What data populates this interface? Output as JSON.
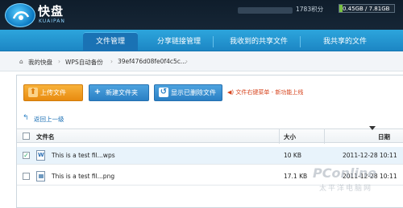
{
  "header": {
    "logo_text": "快盘",
    "logo_sub": "KUAIPAN",
    "points": "1783积分",
    "storage_text": "0.45GB / 7.81GB",
    "storage_used_fraction": 0.058
  },
  "nav": {
    "tabs": [
      {
        "label": "文件管理",
        "active": true
      },
      {
        "label": "分享链接管理",
        "active": false
      },
      {
        "label": "我收到的共享文件",
        "active": false
      },
      {
        "label": "我共享的文件",
        "active": false
      }
    ]
  },
  "breadcrumb": {
    "items": [
      "我的快盘",
      "WPS自动备份",
      "39ef476d08fe0f4c5c..."
    ]
  },
  "toolbar": {
    "upload_label": "上传文件",
    "new_folder_label": "新建文件夹",
    "show_deleted_label": "显示已删除文件",
    "notice": "文件右键菜单 - 新功能上线"
  },
  "back_label": "返回上一级",
  "table": {
    "columns": [
      "文件名",
      "大小",
      "日期"
    ],
    "rows": [
      {
        "name": "This is a test fil...wps",
        "size": "10 KB",
        "date": "2011-12-28 10:11",
        "checked": true,
        "type": "wps"
      },
      {
        "name": "This is a test fil...png",
        "size": "17.1 KB",
        "date": "2011-12-28 10:11",
        "checked": false,
        "type": "png"
      }
    ]
  },
  "watermark": {
    "text": "PConline",
    "sub": "太平洋电脑网"
  },
  "colors": {
    "nav_blue": "#1c86c4",
    "upload_orange": "#e88b10",
    "notice_red": "#d6431c",
    "header_dark": "#0f1d2b"
  }
}
